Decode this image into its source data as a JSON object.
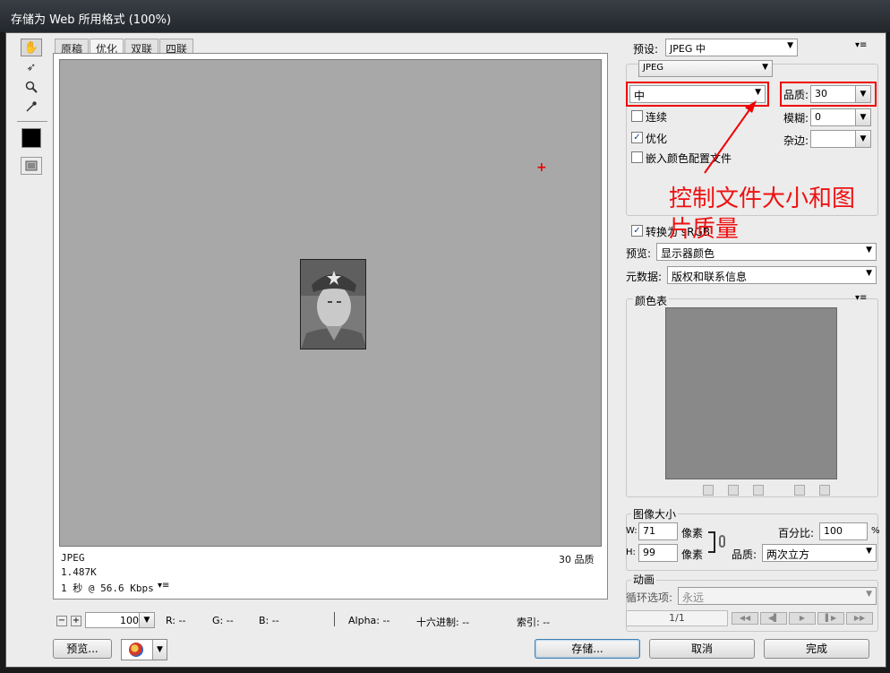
{
  "window": {
    "title": "存储为 Web 所用格式 (100%)"
  },
  "tools": [
    {
      "name": "hand-tool",
      "glyph": "✋"
    },
    {
      "name": "slice-select-tool",
      "glyph": "➶"
    },
    {
      "name": "zoom-tool",
      "glyph": "🔍"
    },
    {
      "name": "eyedropper-tool",
      "glyph": "✎"
    }
  ],
  "tabs": [
    "原稿",
    "优化",
    "双联",
    "四联"
  ],
  "selected_tab": "优化",
  "preview_info": {
    "format": "JPEG",
    "size": "1.487K",
    "speed": "1 秒 @ 56.6 Kbps",
    "quality": "30 品质"
  },
  "status_bar": {
    "zoom": "100%",
    "r": "R: --",
    "g": "G: --",
    "b": "B: --",
    "alpha": "Alpha: --",
    "hex": "十六进制: --",
    "index": "索引: --"
  },
  "bottom_buttons": {
    "preview": "预览...",
    "save": "存储...",
    "cancel": "取消",
    "done": "完成"
  },
  "settings": {
    "preset_label": "预设:",
    "preset_value": "JPEG 中",
    "format_value": "JPEG",
    "quality_level": "中",
    "quality_label": "品质:",
    "quality_value": "30",
    "blur_label": "模糊:",
    "blur_value": "0",
    "matte_label": "杂边:",
    "progressive_label": "连续",
    "progressive_checked": false,
    "optimized_label": "优化",
    "optimized_checked": true,
    "embed_profile_label": "嵌入颜色配置文件",
    "embed_profile_checked": false,
    "convert_srgb_label": "转换为 sRGB",
    "convert_srgb_checked": true,
    "preview_label": "预览:",
    "preview_value": "显示器颜色",
    "metadata_label": "元数据:",
    "metadata_value": "版权和联系信息"
  },
  "annotation": {
    "text": "控制文件大小和图片质量",
    "color": "#ee1111"
  },
  "color_table": {
    "title": "颜色表"
  },
  "image_size": {
    "title": "图像大小",
    "w_label": "W:",
    "w_value": "71",
    "h_label": "H:",
    "h_value": "99",
    "unit": "像素",
    "percent_label": "百分比:",
    "percent_value": "100",
    "percent_unit": "%",
    "quality_label": "品质:",
    "quality_value": "两次立方"
  },
  "animation": {
    "title": "动画",
    "loop_label": "循环选项:",
    "loop_value": "永远",
    "frame": "1/1"
  },
  "colors": {
    "red_box": "#ee0000",
    "canvas": "#a8a8a8"
  }
}
